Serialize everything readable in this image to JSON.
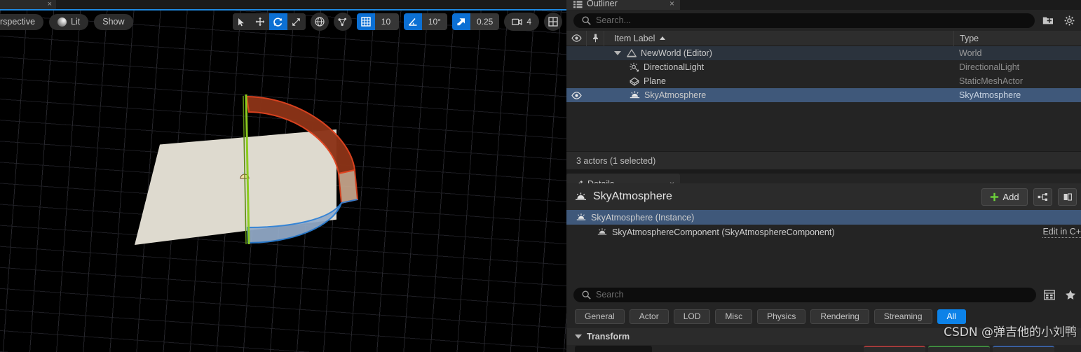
{
  "viewport": {
    "tab_close": "×",
    "perspective_label": "rspective",
    "lit_label": "Lit",
    "show_label": "Show",
    "icons": {
      "select": "select-arrow-icon",
      "translate": "move-icon",
      "rotate": "rotate-icon",
      "scale": "scale-icon",
      "coord_space": "globe-icon",
      "surface_snap": "surface-snap-icon",
      "grid_snap": "grid-snap-icon",
      "angle_snap": "angle-snap-icon",
      "scale_snap": "scale-snap-icon",
      "camera_speed": "camera-icon",
      "layout": "viewport-layout-icon"
    },
    "grid_snap_value": "10",
    "angle_snap_value": "10°",
    "scale_snap_value": "0.25",
    "camera_speed_value": "4",
    "active_tool": "rotate"
  },
  "outliner": {
    "tab_label": "Outliner",
    "tab_close": "×",
    "search_placeholder": "Search...",
    "columns": {
      "item_label": "Item Label",
      "type": "Type"
    },
    "sort": "ascending",
    "rows": [
      {
        "label": "NewWorld (Editor)",
        "type": "World",
        "icon": "world-icon",
        "depth": 1,
        "expander": true,
        "eye": false,
        "selected": false,
        "header": true
      },
      {
        "label": "DirectionalLight",
        "type": "DirectionalLight",
        "icon": "directional-light-icon",
        "depth": 2,
        "expander": false,
        "eye": false,
        "selected": false,
        "header": false
      },
      {
        "label": "Plane",
        "type": "StaticMeshActor",
        "icon": "static-mesh-icon",
        "depth": 2,
        "expander": false,
        "eye": false,
        "selected": false,
        "header": false
      },
      {
        "label": "SkyAtmosphere",
        "type": "SkyAtmosphere",
        "icon": "sky-atmosphere-icon",
        "depth": 2,
        "expander": false,
        "eye": true,
        "selected": true,
        "header": false
      }
    ],
    "status": "3 actors (1 selected)"
  },
  "details": {
    "tab_label": "Details",
    "tab_close": "×",
    "title": "SkyAtmosphere",
    "add_label": "Add",
    "components": [
      {
        "label": "SkyAtmosphere (Instance)",
        "depth": 1,
        "selected": true,
        "link": ""
      },
      {
        "label": "SkyAtmosphereComponent (SkyAtmosphereComponent)",
        "depth": 2,
        "selected": false,
        "link": "Edit in C+"
      }
    ],
    "search_placeholder": "Search",
    "filters": [
      {
        "label": "General",
        "active": false
      },
      {
        "label": "Actor",
        "active": false
      },
      {
        "label": "LOD",
        "active": false
      },
      {
        "label": "Misc",
        "active": false
      },
      {
        "label": "Physics",
        "active": false
      },
      {
        "label": "Rendering",
        "active": false
      },
      {
        "label": "Streaming",
        "active": false
      },
      {
        "label": "All",
        "active": true
      }
    ],
    "sections": [
      {
        "label": "Transform",
        "expanded": true
      }
    ]
  },
  "watermark": "CSDN @弹吉他的小刘鸭",
  "colors": {
    "accent_blue": "#0c82e8",
    "selection_blue": "#3f587a",
    "panel_bg": "#242424",
    "header_bg": "#2b2b2b",
    "gizmo_red": "#cc3d1e",
    "gizmo_green": "#7fc021",
    "gizmo_blue": "#2b7fd6",
    "plane_tan": "#dedacf"
  }
}
